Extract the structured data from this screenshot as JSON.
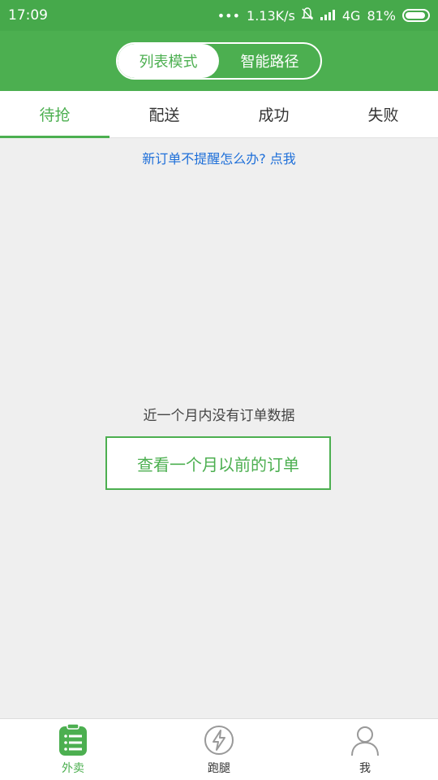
{
  "status_bar": {
    "time": "17:09",
    "dots": "•••",
    "speed": "1.13K/s",
    "mute_icon": "bell-off-icon",
    "signal": "4G",
    "battery_percent": "81%"
  },
  "header": {
    "modes": [
      {
        "label": "列表模式",
        "active": true
      },
      {
        "label": "智能路径",
        "active": false
      }
    ]
  },
  "tabs": [
    {
      "label": "待抢",
      "active": true
    },
    {
      "label": "配送",
      "active": false
    },
    {
      "label": "成功",
      "active": false
    },
    {
      "label": "失败",
      "active": false
    }
  ],
  "notice": {
    "link_text": "新订单不提醒怎么办? 点我"
  },
  "empty_state": {
    "message": "近一个月内没有订单数据",
    "button_label": "查看一个月以前的订单"
  },
  "bottom_nav": [
    {
      "label": "外卖",
      "icon": "order-list-icon",
      "active": true
    },
    {
      "label": "跑腿",
      "icon": "lightning-icon",
      "active": false
    },
    {
      "label": "我",
      "icon": "user-icon",
      "active": false
    }
  ],
  "colors": {
    "primary": "#4caf50",
    "link": "#1e6fd9"
  }
}
